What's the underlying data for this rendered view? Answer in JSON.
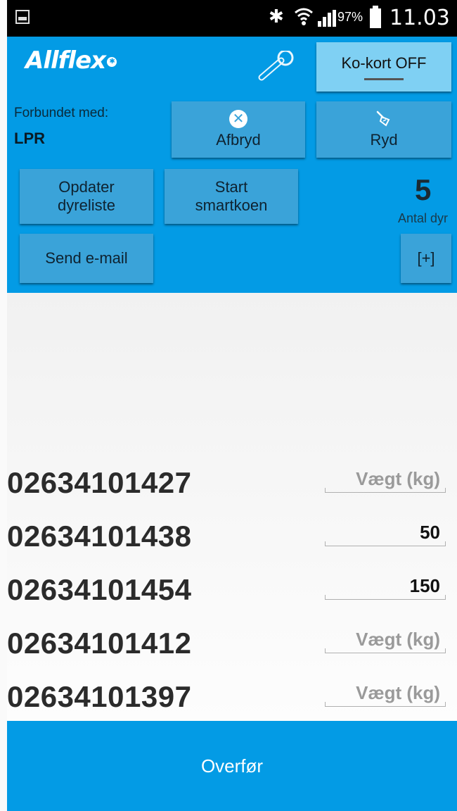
{
  "status_bar": {
    "battery_percent": "97%",
    "time": "11.03"
  },
  "header": {
    "logo_text": "Allflex",
    "kokort_label": "Ko-kort OFF",
    "connection_label": "Forbundet med:",
    "connection_value": "LPR",
    "buttons": {
      "afbryd": "Afbryd",
      "ryd": "Ryd",
      "opdater_line1": "Opdater",
      "opdater_line2": "dyreliste",
      "start_line1": "Start",
      "start_line2": "smartkoen",
      "send_email": "Send e-mail",
      "plus": "[+]"
    },
    "animal_count": "5",
    "animal_count_label": "Antal dyr"
  },
  "animals": [
    {
      "id": "02634101427",
      "weight": "",
      "placeholder": "Vægt (kg)"
    },
    {
      "id": "02634101438",
      "weight": "50",
      "placeholder": "Vægt (kg)"
    },
    {
      "id": "02634101454",
      "weight": "150",
      "placeholder": "Vægt (kg)"
    },
    {
      "id": "02634101412",
      "weight": "",
      "placeholder": "Vægt (kg)"
    },
    {
      "id": "02634101397",
      "weight": "",
      "placeholder": "Vægt (kg)"
    }
  ],
  "footer": {
    "transfer_label": "Overfør"
  },
  "colors": {
    "accent": "#039be5",
    "button": "#3aa3d9",
    "toggle": "#7fd0f3"
  }
}
